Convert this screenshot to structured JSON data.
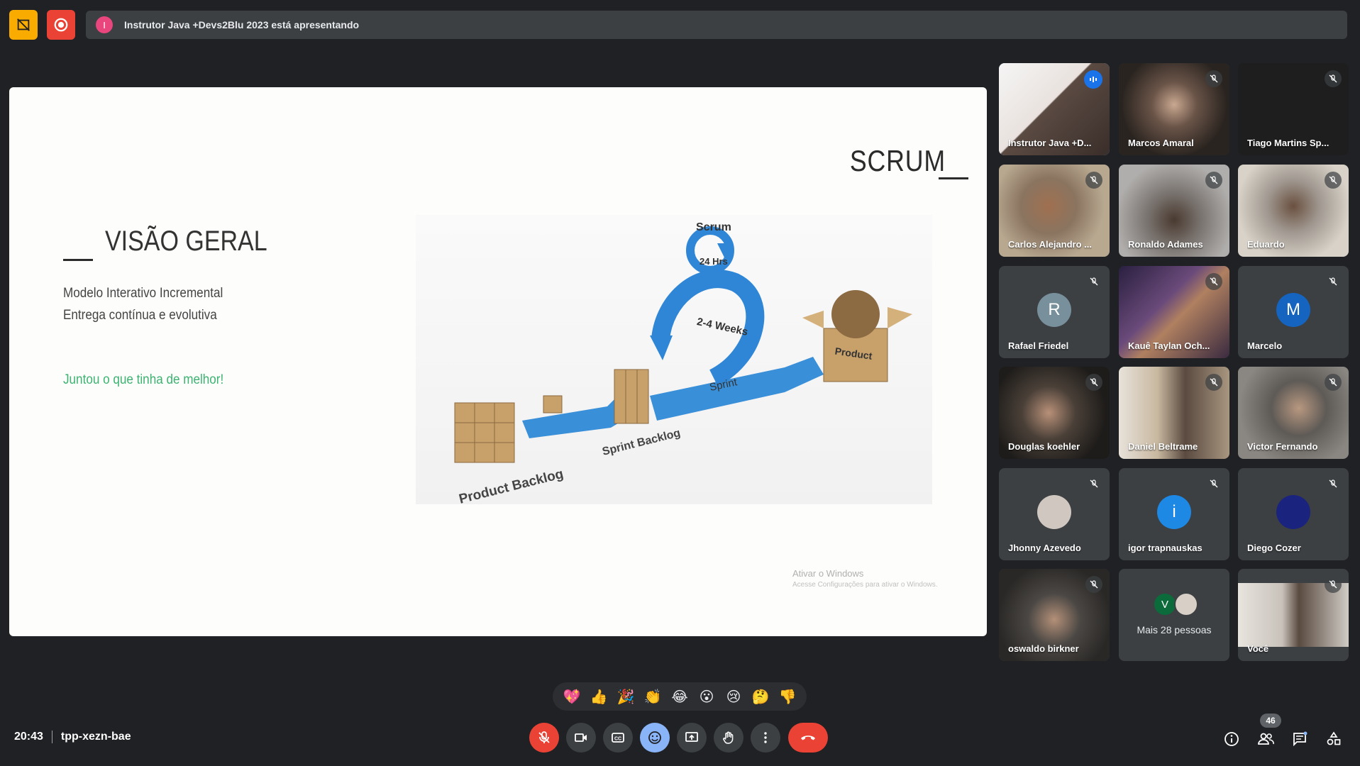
{
  "presenting": {
    "initial": "I",
    "text": "Instrutor Java +Devs2Blu 2023 está apresentando"
  },
  "slide": {
    "title": "SCRUM",
    "section": "VISÃO GERAL",
    "lines": [
      "Modelo Interativo Incremental",
      "Entrega contínua e evolutiva"
    ],
    "highlight": "Juntou o que tinha de melhor!",
    "diagram": {
      "scrum_label": "Scrum",
      "daily_label": "24 Hrs",
      "iteration_label": "2-4 Weeks",
      "sprint_label": "Sprint",
      "product_backlog": "Product Backlog",
      "sprint_backlog": "Sprint Backlog",
      "product": "Product"
    },
    "watermark_title": "Ativar o Windows",
    "watermark_sub": "Acesse Configurações para ativar o Windows."
  },
  "participants": [
    {
      "name": "Instrutor Java +D...",
      "type": "video",
      "bg": "#5a4a42",
      "active": true
    },
    {
      "name": "Marcos Amaral",
      "type": "video",
      "bg": "#4a4038"
    },
    {
      "name": "Tiago Martins Sp...",
      "type": "video",
      "bg": "#1e1e1e"
    },
    {
      "name": "Carlos Alejandro ...",
      "type": "video",
      "bg": "#8a7460"
    },
    {
      "name": "Ronaldo Adames",
      "type": "video",
      "bg": "#8c8a88"
    },
    {
      "name": "Eduardo",
      "type": "video",
      "bg": "#9a9488"
    },
    {
      "name": "Rafael Friedel",
      "type": "avatar",
      "initial": "R",
      "color": "#78909c"
    },
    {
      "name": "Kauê Taylan Och...",
      "type": "video",
      "bg": "#4a3a52"
    },
    {
      "name": "Marcelo",
      "type": "avatar",
      "initial": "M",
      "color": "#1565c0"
    },
    {
      "name": "Douglas koehler",
      "type": "video",
      "bg": "#3a3634"
    },
    {
      "name": "Daniel Beltrame",
      "type": "video",
      "bg": "#a89680"
    },
    {
      "name": "Victor Fernando",
      "type": "video",
      "bg": "#5e5a56"
    },
    {
      "name": "Jhonny Azevedo",
      "type": "avatar",
      "initial": "",
      "color": "#d0c8c0"
    },
    {
      "name": "igor trapnauskas",
      "type": "avatar",
      "initial": "i",
      "color": "#1e88e5"
    },
    {
      "name": "Diego Cozer",
      "type": "avatar",
      "initial": "",
      "color": "#1a237e"
    },
    {
      "name": "oswaldo birkner",
      "type": "video",
      "bg": "#4a4744"
    },
    {
      "name": "Mais 28 pessoas",
      "type": "more",
      "initial": "V"
    },
    {
      "name": "Você",
      "type": "video",
      "bg": "#d8d4ce"
    }
  ],
  "reactions": [
    "💖",
    "👍",
    "🎉",
    "👏",
    "😂",
    "😮",
    "😢",
    "🤔",
    "👎"
  ],
  "meeting": {
    "time": "20:43",
    "code": "tpp-xezn-bae"
  },
  "people_count": "46",
  "colors": {
    "end_call": "#ea4335",
    "accent": "#8ab4f8",
    "highlight_text": "#3cb371"
  }
}
